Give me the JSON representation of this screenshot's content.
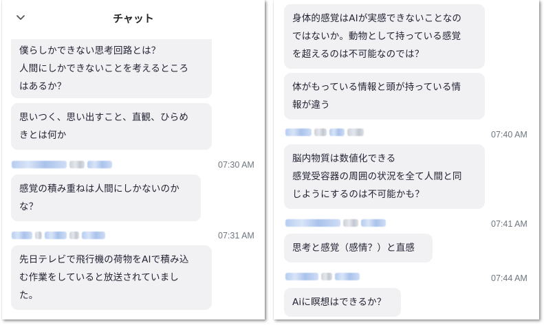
{
  "left_panel": {
    "title": "チャット",
    "messages": [
      {
        "lines": [
          "僕らしかできない思考回路とは？",
          "人間にしかできないことを考えるところ",
          "はあるか？"
        ]
      },
      {
        "lines": [
          "思いつく、思い出すこと、直観、ひらめ",
          "きとは何か"
        ]
      },
      {
        "time": "07:30 AM",
        "lines": [
          "感覚の積み重ねは人間にしかないのか",
          "な？"
        ]
      },
      {
        "time": "07:31 AM",
        "lines": [
          "先日テレビで飛行機の荷物をAIで積み込",
          "む作業をしていると放送されていまし",
          "た。"
        ]
      }
    ]
  },
  "right_panel": {
    "messages": [
      {
        "lines": [
          "身体的感覚はAIが実感できないことなの",
          "ではないか。動物として持っている感覚",
          "を超えるのは不可能なのでは？"
        ]
      },
      {
        "lines": [
          "体がもっている情報と頭が持っている情",
          "報が違う"
        ]
      },
      {
        "time": "07:40 AM",
        "lines": [
          "脳内物質は数値化できる",
          "感覚受容器の周囲の状況を全て人間と同",
          "じようにするのは不可能かも？"
        ]
      },
      {
        "time": "07:41 AM",
        "lines": [
          "思考と感覚（感情？）と直感"
        ]
      },
      {
        "time": "07:44 AM",
        "lines": [
          "Aiに瞑想はできるか？"
        ]
      }
    ]
  }
}
